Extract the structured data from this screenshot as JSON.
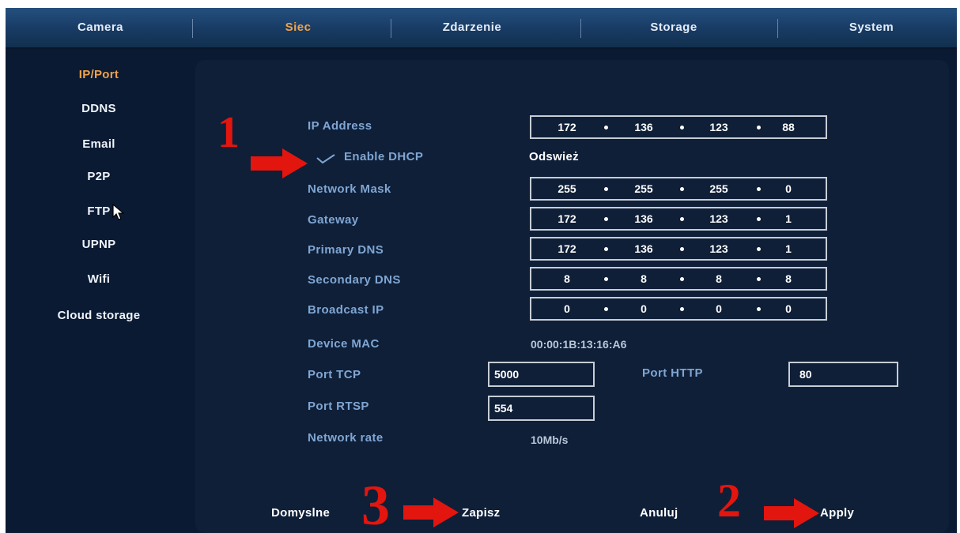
{
  "tabs": [
    {
      "label": "Camera"
    },
    {
      "label": "Siec"
    },
    {
      "label": "Zdarzenie"
    },
    {
      "label": "Storage"
    },
    {
      "label": "System"
    }
  ],
  "sidebar": {
    "items": [
      {
        "label": "IP/Port"
      },
      {
        "label": "DDNS"
      },
      {
        "label": "Email"
      },
      {
        "label": "P2P"
      },
      {
        "label": "FTP"
      },
      {
        "label": "UPNP"
      },
      {
        "label": "Wifi"
      },
      {
        "label": "Cloud storage"
      }
    ],
    "active": "IP/Port"
  },
  "form": {
    "ip_address": {
      "label": "IP Address",
      "octets": [
        "172",
        "136",
        "123",
        "88"
      ]
    },
    "dhcp": {
      "label": "Enable DHCP",
      "checked": true,
      "refresh_label": "Odswież"
    },
    "network_mask": {
      "label": "Network Mask",
      "octets": [
        "255",
        "255",
        "255",
        "0"
      ]
    },
    "gateway": {
      "label": "Gateway",
      "octets": [
        "172",
        "136",
        "123",
        "1"
      ]
    },
    "primary_dns": {
      "label": "Primary DNS",
      "octets": [
        "172",
        "136",
        "123",
        "1"
      ]
    },
    "secondary_dns": {
      "label": "Secondary DNS",
      "octets": [
        "8",
        "8",
        "8",
        "8"
      ]
    },
    "broadcast_ip": {
      "label": "Broadcast IP",
      "octets": [
        "0",
        "0",
        "0",
        "0"
      ]
    },
    "device_mac": {
      "label": "Device MAC",
      "value": "00:00:1B:13:16:A6"
    },
    "port_tcp": {
      "label": "Port TCP",
      "value": "5000"
    },
    "port_http": {
      "label": "Port HTTP",
      "value": "80"
    },
    "port_rtsp": {
      "label": "Port RTSP",
      "value": "554"
    },
    "network_rate": {
      "label": "Network rate",
      "value": "10Mb/s"
    }
  },
  "buttons": {
    "default": "Domyslne",
    "save": "Zapisz",
    "cancel": "Anuluj",
    "apply": "Apply"
  },
  "annotations": {
    "step1": "1",
    "step2": "2",
    "step3": "3"
  },
  "colors": {
    "active_tab": "#f0a24a",
    "label": "#7fa6d3",
    "annotation_red": "#e3150f"
  }
}
